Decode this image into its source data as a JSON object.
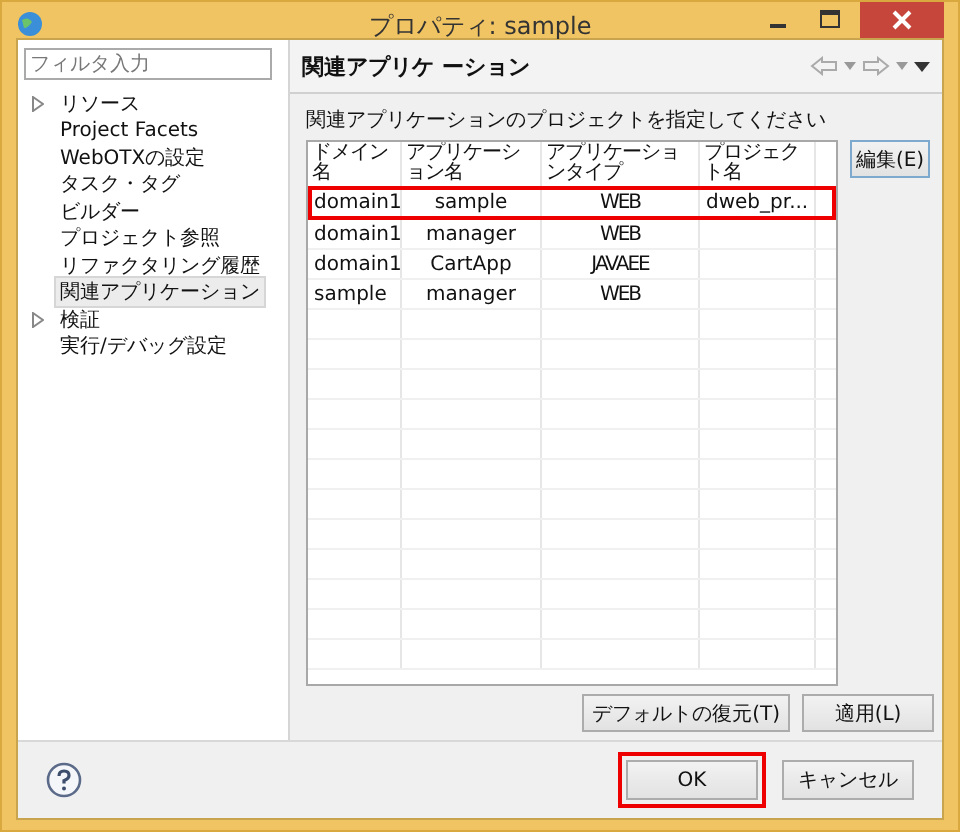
{
  "window": {
    "title": "プロパティ: sample"
  },
  "sidebar": {
    "filter": {
      "placeholder": "フィルタ入力"
    },
    "items": [
      {
        "label": "リソース",
        "kind": "folder",
        "selected": false
      },
      {
        "label": "Project Facets",
        "kind": "page",
        "selected": false
      },
      {
        "label": "WebOTXの設定",
        "kind": "page",
        "selected": false
      },
      {
        "label": "タスク・タグ",
        "kind": "page",
        "selected": false
      },
      {
        "label": "ビルダー",
        "kind": "page",
        "selected": false
      },
      {
        "label": "プロジェクト参照",
        "kind": "page",
        "selected": false
      },
      {
        "label": "リファクタリング履歴",
        "kind": "page",
        "selected": false
      },
      {
        "label": "関連アプリケーション",
        "kind": "page",
        "selected": true
      },
      {
        "label": "検証",
        "kind": "folder",
        "selected": false
      },
      {
        "label": "実行/デバッグ設定",
        "kind": "page",
        "selected": false
      }
    ]
  },
  "page": {
    "title": "関連アプリケ ーション",
    "description": "関連アプリケーションのプロジェクトを指定してください",
    "table": {
      "columns": [
        "ドメイン名",
        "アプリケーション名",
        "アプリケーションタイプ",
        "プロジェクト名"
      ],
      "rows": [
        {
          "cells": [
            "domain1",
            "sample",
            "WEB",
            "dweb_pr..."
          ],
          "highlighted": true
        },
        {
          "cells": [
            "domain1",
            "manager",
            "WEB",
            ""
          ],
          "highlighted": false
        },
        {
          "cells": [
            "domain1",
            "CartApp",
            "JAVAEE",
            ""
          ],
          "highlighted": false
        },
        {
          "cells": [
            "sample",
            "manager",
            "WEB",
            ""
          ],
          "highlighted": false
        }
      ]
    },
    "edit_button": "編集(E)",
    "buttons": [
      "デフォルトの復元(T)",
      "適用(L)"
    ]
  },
  "footer": {
    "buttons": [
      {
        "label": "OK",
        "highlighted": true
      },
      {
        "label": "キャンセル",
        "highlighted": false
      }
    ]
  }
}
